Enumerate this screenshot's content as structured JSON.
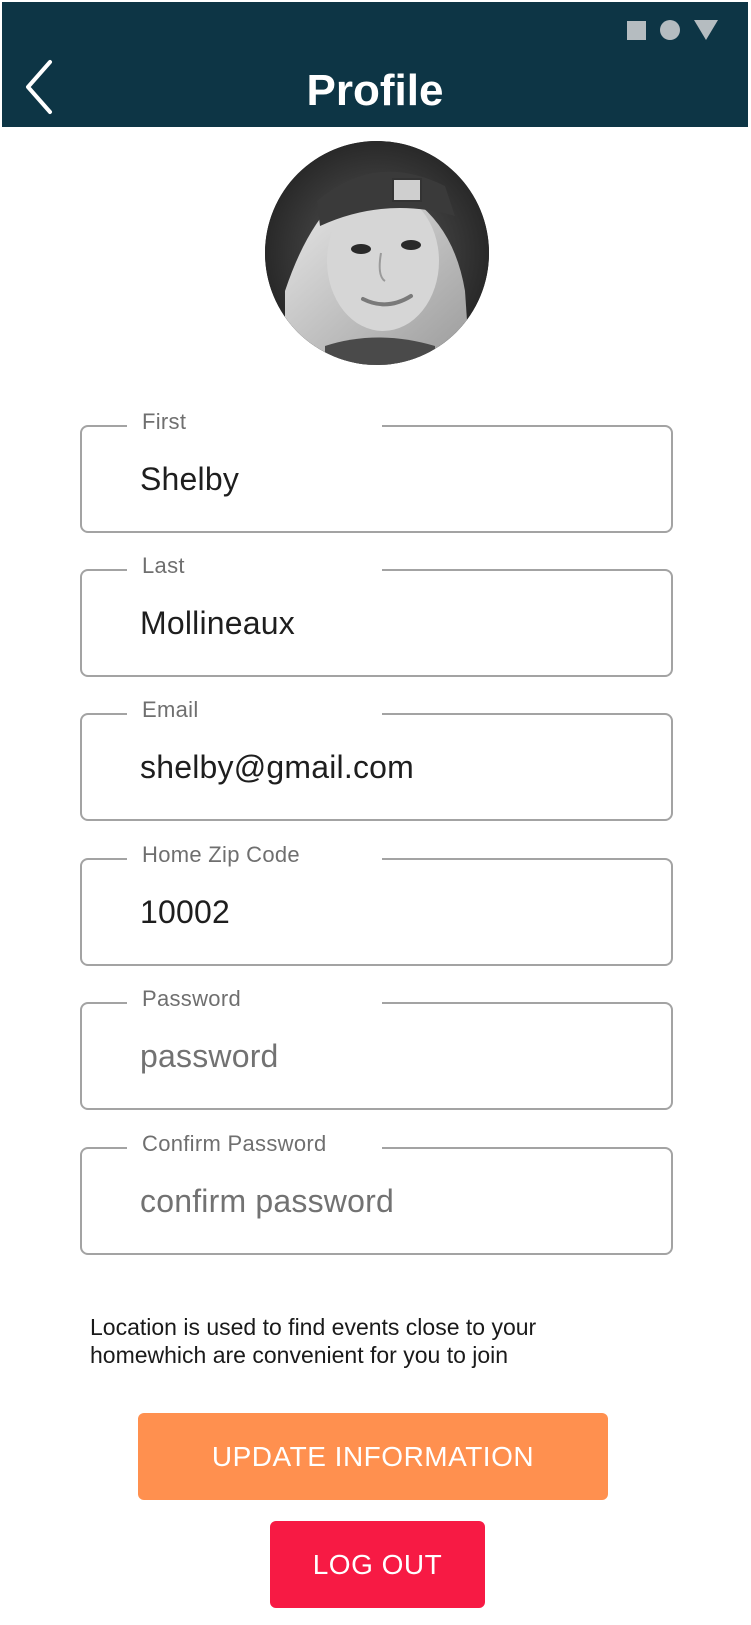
{
  "header": {
    "title": "Profile",
    "back_icon": "chevron-left-icon",
    "background_color": "#0d3545"
  },
  "status_bar": {
    "icons": [
      "square-icon",
      "circle-icon",
      "triangle-icon"
    ]
  },
  "profile": {
    "avatar": "avatar-photo"
  },
  "form": {
    "first": {
      "label": "First",
      "value": "Shelby",
      "placeholder": ""
    },
    "last": {
      "label": "Last",
      "value": "Mollineaux",
      "placeholder": ""
    },
    "email": {
      "label": "Email",
      "value": "shelby@gmail.com",
      "placeholder": ""
    },
    "zip": {
      "label": "Home Zip Code",
      "value": "10002",
      "placeholder": ""
    },
    "password": {
      "label": "Password",
      "value": "",
      "placeholder": "password"
    },
    "confirm_password": {
      "label": "Confirm Password",
      "value": "",
      "placeholder": "confirm password"
    }
  },
  "info_text": "Location is used to find events close to your homewhich are convenient for you to join",
  "actions": {
    "update_label": "UPDATE INFORMATION",
    "update_color": "#ff904f",
    "logout_label": "LOG OUT",
    "logout_color": "#f71a44"
  }
}
